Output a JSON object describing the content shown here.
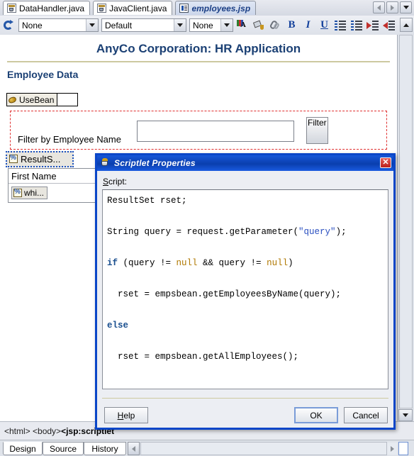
{
  "editor_tabs": [
    {
      "label": "DataHandler.java",
      "icon": "java-file-icon",
      "active": false
    },
    {
      "label": "JavaClient.java",
      "icon": "java-file-icon",
      "active": false
    },
    {
      "label": "employees.jsp",
      "icon": "jsp-file-icon",
      "active": true
    }
  ],
  "tab_nav": {
    "prev_icon": "chevron-left-icon",
    "next_icon": "chevron-right-icon",
    "list_icon": "chevron-down-icon"
  },
  "toolbar": {
    "refresh_icon": "refresh-icon",
    "style_combo": {
      "value": "None",
      "arrow_icon": "chevron-down-icon"
    },
    "font_combo": {
      "value": "Default",
      "arrow_icon": "chevron-down-icon"
    },
    "size_combo": {
      "value": "None",
      "arrow_icon": "chevron-down-icon"
    },
    "buttons": [
      {
        "name": "font-color-icon",
        "label": "A"
      },
      {
        "name": "fill-color-icon",
        "label": ""
      },
      {
        "name": "link-icon",
        "label": ""
      },
      {
        "name": "bold-icon",
        "label": "B"
      },
      {
        "name": "italic-icon",
        "label": "I"
      },
      {
        "name": "underline-icon",
        "label": "U"
      },
      {
        "name": "ordered-list-icon",
        "label": ""
      },
      {
        "name": "unordered-list-icon",
        "label": ""
      },
      {
        "name": "indent-icon",
        "label": ""
      },
      {
        "name": "outdent-icon",
        "label": ""
      },
      {
        "name": "align-icon",
        "label": ""
      }
    ],
    "scroll_up_icon": "scroll-up-icon"
  },
  "canvas": {
    "page_title": "AnyCo Corporation: HR Application",
    "section_title": "Employee Data",
    "usebean": {
      "label": "UseBean",
      "icon": "bean-icon"
    },
    "filter_form": {
      "label": "Filter by Employee Name",
      "input_value": "",
      "input_placeholder": "",
      "button_label": "Filter"
    },
    "resultset_chip": {
      "label": "ResultS...",
      "icon": "scriptlet-icon",
      "selected": true
    },
    "table": {
      "columns": [
        "First Name"
      ],
      "rows": [
        {
          "label": "whi...",
          "icon": "scriptlet-icon"
        }
      ]
    },
    "accent_color": "#1b4074",
    "rule_color": "#cdc9a1",
    "dashed_outline_color": "#e03030",
    "selection_color": "#1b52c0"
  },
  "scrollbars": {
    "vertical_down_icon": "chevron-down-icon",
    "horizontal_left_icon": "chevron-left-icon",
    "horizontal_right_icon": "chevron-right-icon"
  },
  "statusbar": {
    "breadcrumb_prefix": "<html> <body> ",
    "breadcrumb_current": "<jsp:scriptlet"
  },
  "bottom_tabs": [
    {
      "label": "Design",
      "selected": true
    },
    {
      "label": "Source",
      "selected": false
    },
    {
      "label": "History",
      "selected": false
    }
  ],
  "dialog": {
    "title": "Scriptlet Properties",
    "title_icon": "java-cup-icon",
    "close_icon": "close-icon",
    "script_label": "Script:",
    "script_label_mnemonic": "S",
    "code_lines": [
      {
        "segments": [
          {
            "t": "ResultSet rset;",
            "c": ""
          }
        ]
      },
      {
        "segments": [
          {
            "t": "",
            "c": ""
          }
        ]
      },
      {
        "segments": [
          {
            "t": "String query = request.getParameter(",
            "c": ""
          },
          {
            "t": "\"query\"",
            "c": "str"
          },
          {
            "t": ");",
            "c": ""
          }
        ]
      },
      {
        "segments": [
          {
            "t": "",
            "c": ""
          }
        ]
      },
      {
        "segments": [
          {
            "t": "if",
            "c": "kw"
          },
          {
            "t": " (query != ",
            "c": ""
          },
          {
            "t": "null",
            "c": "lit"
          },
          {
            "t": " && query != ",
            "c": ""
          },
          {
            "t": "null",
            "c": "lit"
          },
          {
            "t": ")",
            "c": ""
          }
        ]
      },
      {
        "segments": [
          {
            "t": "",
            "c": ""
          }
        ]
      },
      {
        "segments": [
          {
            "t": "  rset = empsbean.getEmployeesByName(query);",
            "c": ""
          }
        ]
      },
      {
        "segments": [
          {
            "t": "",
            "c": ""
          }
        ]
      },
      {
        "segments": [
          {
            "t": "else",
            "c": "kw"
          }
        ]
      },
      {
        "segments": [
          {
            "t": "",
            "c": ""
          }
        ]
      },
      {
        "segments": [
          {
            "t": "  rset = empsbean.getAllEmployees();",
            "c": ""
          }
        ]
      }
    ],
    "buttons": {
      "help": {
        "label": "Help",
        "mnemonic": "H"
      },
      "ok": {
        "label": "OK",
        "default": true
      },
      "cancel": {
        "label": "Cancel"
      }
    },
    "titlebar_color": "#0a3fae",
    "border_color": "#0a46c8"
  }
}
